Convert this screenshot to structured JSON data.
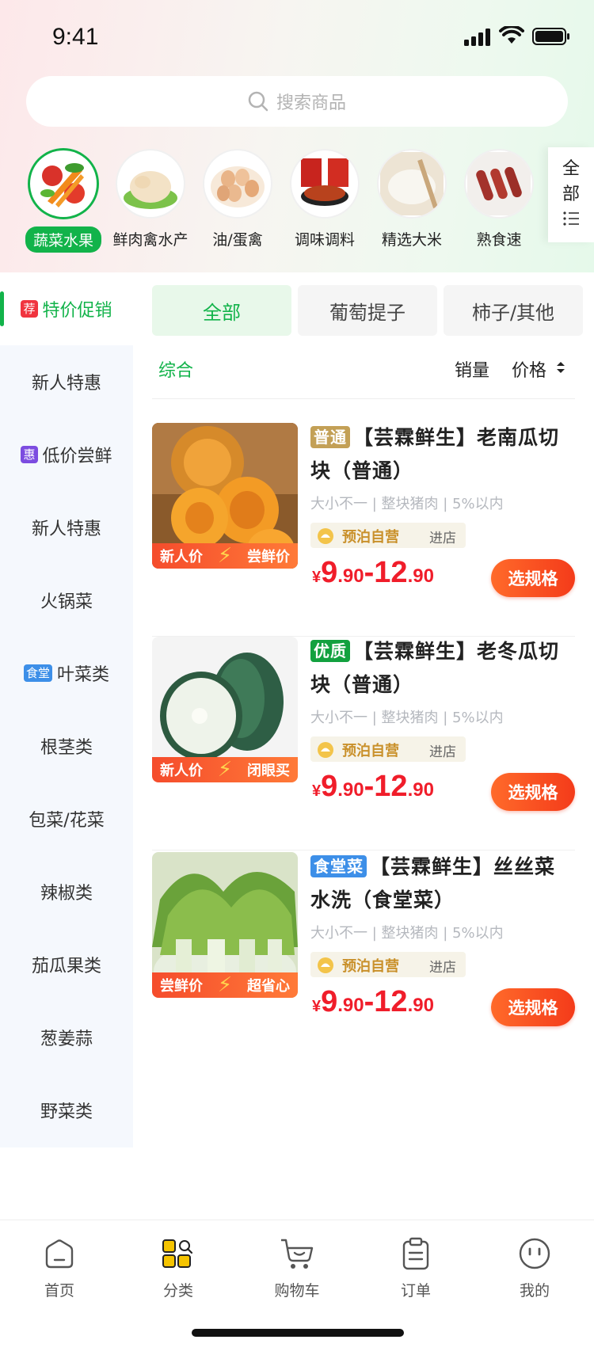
{
  "status": {
    "time": "9:41"
  },
  "search": {
    "placeholder": "搜索商品"
  },
  "categories": [
    {
      "label": "蔬菜水果",
      "active": true
    },
    {
      "label": "鲜肉禽水产"
    },
    {
      "label": "油/蛋禽"
    },
    {
      "label": "调味调料"
    },
    {
      "label": "精选大米"
    },
    {
      "label": "熟食速"
    }
  ],
  "all_categories": {
    "label_1": "全",
    "label_2": "部"
  },
  "sidebar": {
    "items": [
      {
        "label": "特价促销",
        "badge": "荐",
        "badge_color": "#f0343f",
        "active": true
      },
      {
        "label": "新人特惠"
      },
      {
        "label": "低价尝鲜",
        "badge": "惠",
        "badge_color": "#7c4ce0"
      },
      {
        "label": "新人特惠"
      },
      {
        "label": "火锅菜"
      },
      {
        "label": "叶菜类",
        "badge": "食堂",
        "badge_color": "#3d8fe8"
      },
      {
        "label": "根茎类"
      },
      {
        "label": "包菜/花菜"
      },
      {
        "label": "辣椒类"
      },
      {
        "label": "茄瓜果类"
      },
      {
        "label": "葱姜蒜"
      },
      {
        "label": "野菜类"
      }
    ]
  },
  "subtabs": [
    {
      "label": "全部",
      "active": true
    },
    {
      "label": "葡萄提子"
    },
    {
      "label": "柿子/其他"
    }
  ],
  "sort": {
    "overall": "综合",
    "sales": "销量",
    "price": "价格"
  },
  "products": [
    {
      "tag": "普通",
      "tag_color": "#c3a056",
      "title": "【芸霖鲜生】老南瓜切块（普通）",
      "spec": "大小不一 | 整块猪肉 | 5%以内",
      "store": "预泊自营",
      "go": "进店",
      "promo_left": "新人价",
      "promo_right": "尝鲜价",
      "price_yen": "¥",
      "price_a_big": "9",
      "price_a_small": ".90",
      "price_dash": "-",
      "price_b_big": "12",
      "price_b_small": ".90",
      "button": "选规格"
    },
    {
      "tag": "优质",
      "tag_color": "#12a13f",
      "title": "【芸霖鲜生】老冬瓜切块（普通）",
      "spec": "大小不一 | 整块猪肉 | 5%以内",
      "store": "预泊自营",
      "go": "进店",
      "promo_left": "新人价",
      "promo_right": "闭眼买",
      "price_yen": "¥",
      "price_a_big": "9",
      "price_a_small": ".90",
      "price_dash": "-",
      "price_b_big": "12",
      "price_b_small": ".90",
      "button": "选规格"
    },
    {
      "tag": "食堂菜",
      "tag_color": "#3d8fe8",
      "title": "【芸霖鲜生】丝丝菜水洗（食堂菜）",
      "spec": "大小不一 | 整块猪肉 | 5%以内",
      "store": "预泊自营",
      "go": "进店",
      "promo_left": "尝鲜价",
      "promo_right": "超省心",
      "price_yen": "¥",
      "price_a_big": "9",
      "price_a_small": ".90",
      "price_dash": "-",
      "price_b_big": "12",
      "price_b_small": ".90",
      "button": "选规格"
    }
  ],
  "tabbar": [
    {
      "label": "首页",
      "icon": "home-icon"
    },
    {
      "label": "分类",
      "icon": "category-icon",
      "active": true
    },
    {
      "label": "购物车",
      "icon": "cart-icon"
    },
    {
      "label": "订单",
      "icon": "order-icon"
    },
    {
      "label": "我的",
      "icon": "profile-icon"
    }
  ],
  "colors": {
    "accent": "#12b34a",
    "price": "#f01d2a",
    "button": "#f43b1a"
  }
}
